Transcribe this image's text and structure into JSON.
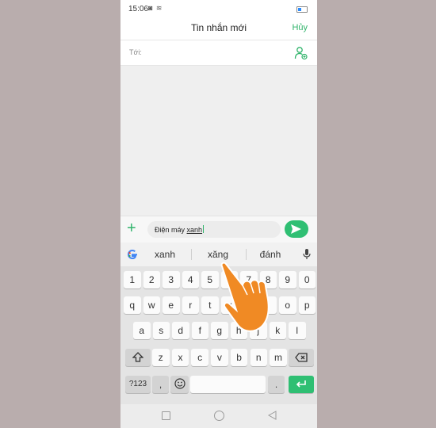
{
  "status": {
    "time": "15:06",
    "icons": "◙ ≋"
  },
  "header": {
    "title": "Tin nhắn mới",
    "cancel": "Hủy"
  },
  "to": {
    "label": "Tới:"
  },
  "compose": {
    "text_before": "Điện máy ",
    "text_underlined": "xanh"
  },
  "suggestions": [
    "xanh",
    "xăng",
    "đánh"
  ],
  "keyboard": {
    "row1": [
      "1",
      "2",
      "3",
      "4",
      "5",
      "6",
      "7",
      "8",
      "9",
      "0"
    ],
    "row2": [
      "q",
      "w",
      "e",
      "r",
      "t",
      "y",
      "u",
      "i",
      "o",
      "p"
    ],
    "row3": [
      "a",
      "s",
      "d",
      "f",
      "g",
      "h",
      "j",
      "k",
      "l"
    ],
    "row4": [
      "z",
      "x",
      "c",
      "v",
      "b",
      "n",
      "m"
    ],
    "symbols_label": "?123",
    "comma": ",",
    "period": "."
  },
  "colors": {
    "accent": "#2fbf73",
    "background": "#b9adad"
  },
  "icons": [
    "camera-icon",
    "wifi-icon",
    "battery-icon",
    "add-contact-icon",
    "plus-icon",
    "send-icon",
    "google-icon",
    "mic-icon",
    "shift-icon",
    "backspace-icon",
    "emoji-icon",
    "enter-icon",
    "recents-icon",
    "home-icon",
    "back-icon",
    "hand-pointer-icon"
  ]
}
